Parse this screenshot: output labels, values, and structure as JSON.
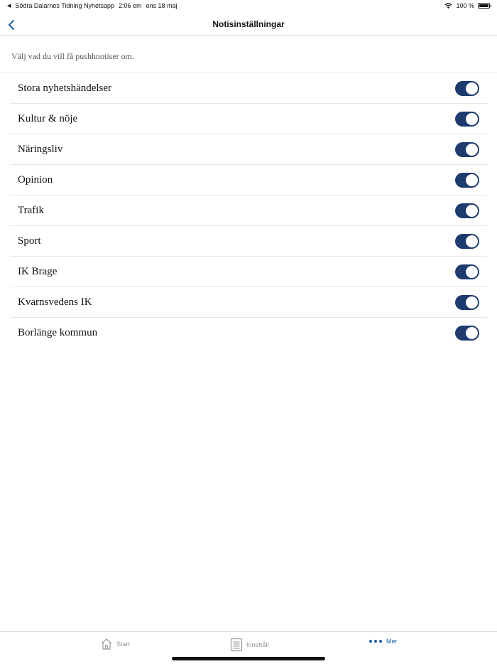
{
  "status_bar": {
    "back_app": "Södra Dalarnes Tidning Nyhetsapp",
    "time": "2:06 em",
    "date": "ons 18 maj",
    "battery": "100 %"
  },
  "nav": {
    "title": "Notisinställningar"
  },
  "intro": "Välj vad du vill få pushhnotiser om.",
  "settings": [
    {
      "label": "Stora nyhetshändelser",
      "enabled": true
    },
    {
      "label": "Kultur & nöje",
      "enabled": true
    },
    {
      "label": "Näringsliv",
      "enabled": true
    },
    {
      "label": "Opinion",
      "enabled": true
    },
    {
      "label": "Trafik",
      "enabled": true
    },
    {
      "label": "Sport",
      "enabled": true
    },
    {
      "label": "IK Brage",
      "enabled": true
    },
    {
      "label": "Kvarnsvedens IK",
      "enabled": true
    },
    {
      "label": "Borlänge kommun",
      "enabled": true
    }
  ],
  "tabs": {
    "start": "Start",
    "content": "Innehåll",
    "more": "Mer"
  },
  "colors": {
    "toggle_on": "#1d3b6e",
    "accent": "#1d5fa8"
  }
}
